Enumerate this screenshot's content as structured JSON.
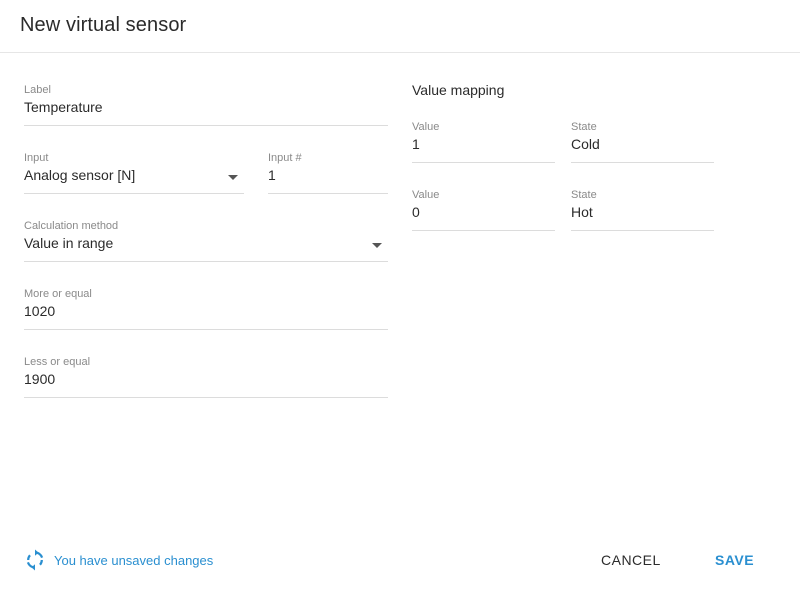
{
  "dialog": {
    "title": "New virtual sensor"
  },
  "form": {
    "label": {
      "label": "Label",
      "value": "Temperature"
    },
    "input": {
      "label": "Input",
      "value": "Analog sensor [N]"
    },
    "input_number": {
      "label": "Input #",
      "value": "1"
    },
    "calculation_method": {
      "label": "Calculation method",
      "value": "Value in range"
    },
    "more_or_equal": {
      "label": "More or equal",
      "value": "1020"
    },
    "less_or_equal": {
      "label": "Less or equal",
      "value": "1900"
    }
  },
  "value_mapping": {
    "title": "Value mapping",
    "rows": [
      {
        "value_label": "Value",
        "value": "1",
        "state_label": "State",
        "state": "Cold"
      },
      {
        "value_label": "Value",
        "value": "0",
        "state_label": "State",
        "state": "Hot"
      }
    ]
  },
  "footer": {
    "status_text": "You have unsaved changes",
    "cancel_label": "CANCEL",
    "save_label": "SAVE"
  },
  "colors": {
    "accent": "#2a8fd0",
    "text": "#2b2b2b",
    "label": "#8a8a8a",
    "divider": "#dcdcdc"
  },
  "icons": {
    "status": "sync-icon",
    "dropdown": "caret-down-icon"
  }
}
